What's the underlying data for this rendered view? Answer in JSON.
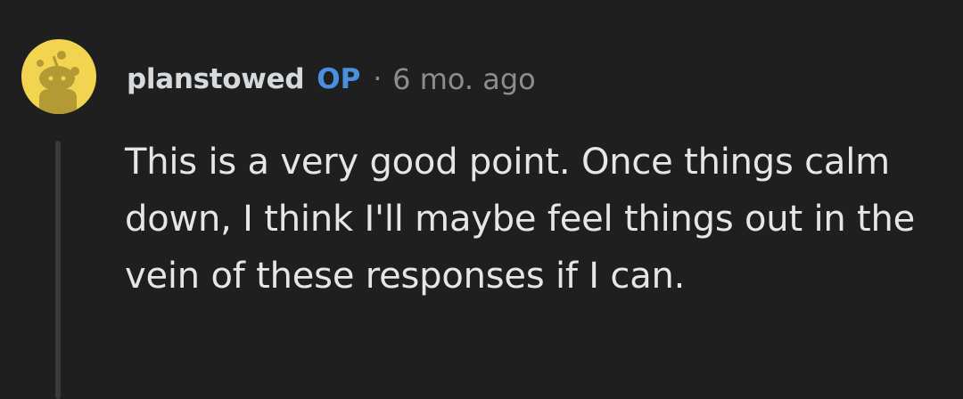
{
  "comment": {
    "avatar_icon": "reddit-snoo-avatar-icon",
    "username": "planstowed",
    "badge": "OP",
    "separator": "·",
    "timestamp": "6 mo. ago",
    "body": "This is a very good point. Once things calm down, I think I'll maybe feel things out in the vein of these responses if I can."
  },
  "colors": {
    "background": "#1f1f1f",
    "avatar_bg": "#f2d451",
    "op_badge": "#4a8fe0",
    "muted_text": "#8d8d8d",
    "body_text": "#e6e6e6"
  }
}
